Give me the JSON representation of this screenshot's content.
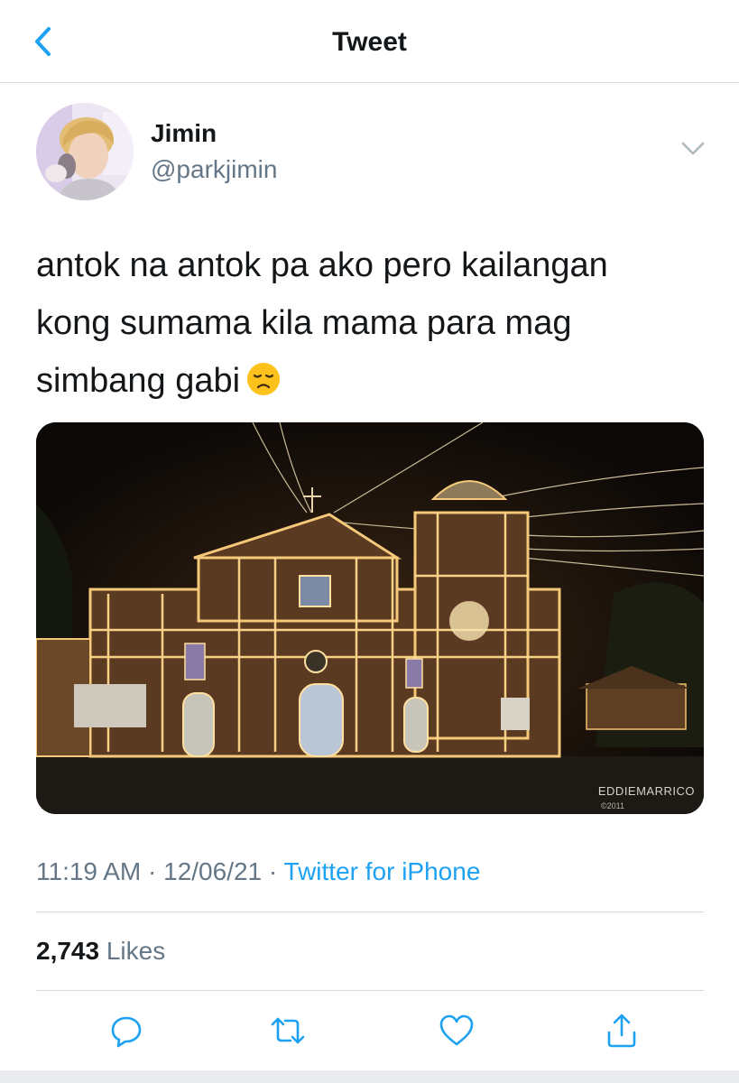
{
  "nav": {
    "title": "Tweet",
    "back_icon": "chevron-left-icon"
  },
  "author": {
    "name": "Jimin",
    "handle": "@parkjimin",
    "avatar_icon": "avatar-photo",
    "more_icon": "chevron-down-icon"
  },
  "tweet": {
    "lines": [
      "antok na antok pa ako pero kailangan",
      "kong sumama kila mama para mag",
      "simbang gabi"
    ],
    "emoji": "disappointed-face-emoji",
    "media": {
      "watermark": "EDDIEMARRICO",
      "watermark_year": "©2011"
    }
  },
  "meta": {
    "time": "11:19 AM",
    "sep1": " · ",
    "date": "12/06/21",
    "sep2": " · ",
    "source": "Twitter for iPhone"
  },
  "stats": {
    "likes_count": "2,743",
    "likes_label": " Likes"
  },
  "actions": [
    {
      "icon": "reply-icon"
    },
    {
      "icon": "retweet-icon"
    },
    {
      "icon": "like-icon"
    },
    {
      "icon": "share-icon"
    }
  ],
  "colors": {
    "accent": "#1da1f2",
    "text": "#14171a",
    "secondary": "#657786",
    "divider": "#d6d9dc"
  }
}
